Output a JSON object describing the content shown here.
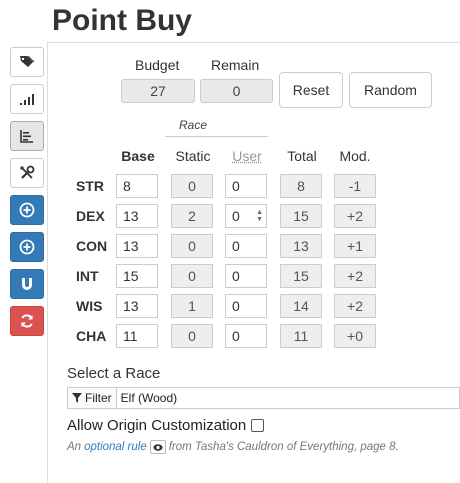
{
  "title": "Point Buy",
  "sidebar": [
    {
      "icon": "tag-icon"
    },
    {
      "icon": "bar-chart-icon"
    },
    {
      "icon": "list-chart-icon"
    },
    {
      "icon": "tools-icon"
    },
    {
      "icon": "plus-circle-icon"
    },
    {
      "icon": "plus-circle-icon"
    },
    {
      "icon": "magnet-icon"
    },
    {
      "icon": "refresh-icon"
    }
  ],
  "budget": {
    "label": "Budget",
    "value": "27"
  },
  "remain": {
    "label": "Remain",
    "value": "0"
  },
  "buttons": {
    "reset": "Reset",
    "random": "Random"
  },
  "race_group_label": "Race",
  "headers": {
    "base": "Base",
    "static": "Static",
    "user": "User",
    "total": "Total",
    "mod": "Mod."
  },
  "stats": [
    {
      "name": "STR",
      "base": "8",
      "static": "0",
      "user": "0",
      "total": "8",
      "mod": "-1"
    },
    {
      "name": "DEX",
      "base": "13",
      "static": "2",
      "user": "0",
      "total": "15",
      "mod": "+2"
    },
    {
      "name": "CON",
      "base": "13",
      "static": "0",
      "user": "0",
      "total": "13",
      "mod": "+1"
    },
    {
      "name": "INT",
      "base": "15",
      "static": "0",
      "user": "0",
      "total": "15",
      "mod": "+2"
    },
    {
      "name": "WIS",
      "base": "13",
      "static": "1",
      "user": "0",
      "total": "14",
      "mod": "+2"
    },
    {
      "name": "CHA",
      "base": "11",
      "static": "0",
      "user": "0",
      "total": "11",
      "mod": "+0"
    }
  ],
  "race_select": {
    "label": "Select a Race",
    "filter": "Filter",
    "value": "Elf (Wood)"
  },
  "origin": {
    "label": "Allow Origin Customization",
    "note_prefix": "An",
    "note_link": "optional rule",
    "note_suffix": "from Tasha's Cauldron of Everything, page 8."
  },
  "colors": {
    "blue": "#337ab7",
    "red": "#d9534f",
    "link": "#337ab7"
  }
}
